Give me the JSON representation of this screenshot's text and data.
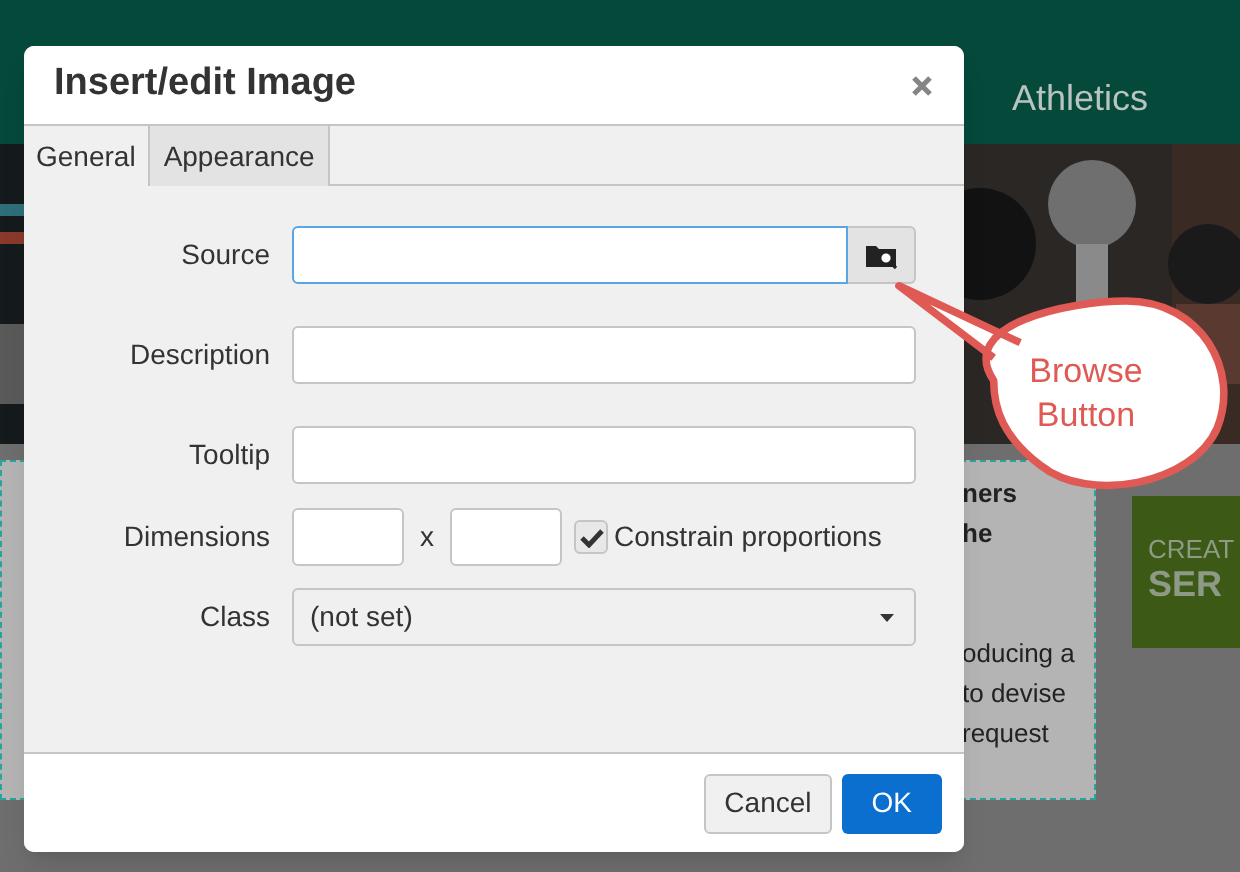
{
  "background": {
    "nav_item": "Athletics",
    "right_text": [
      "ners",
      "he",
      "oducing a",
      "to devise",
      "request"
    ],
    "banner": [
      "CREAT",
      "SER"
    ]
  },
  "dialog": {
    "title": "Insert/edit Image",
    "tabs": [
      {
        "label": "General",
        "selected": true
      },
      {
        "label": "Appearance",
        "selected": false
      }
    ],
    "fields": [
      {
        "kind": "text",
        "label": "Source",
        "focused": true,
        "browse": true
      },
      {
        "kind": "text",
        "label": "Description",
        "focused": false
      },
      {
        "kind": "text",
        "label": "Tooltip",
        "focused": false
      },
      {
        "kind": "dimensions",
        "label": "Dimensions",
        "separator": "x",
        "checkbox": {
          "label": "Constrain proportions",
          "checked": true
        }
      },
      {
        "kind": "select",
        "label": "Class",
        "value": "(not set)"
      }
    ],
    "buttons": [
      {
        "label": "Cancel",
        "primary": false
      },
      {
        "label": "OK",
        "primary": true
      }
    ]
  },
  "callout": {
    "text": "Browse Button"
  }
}
